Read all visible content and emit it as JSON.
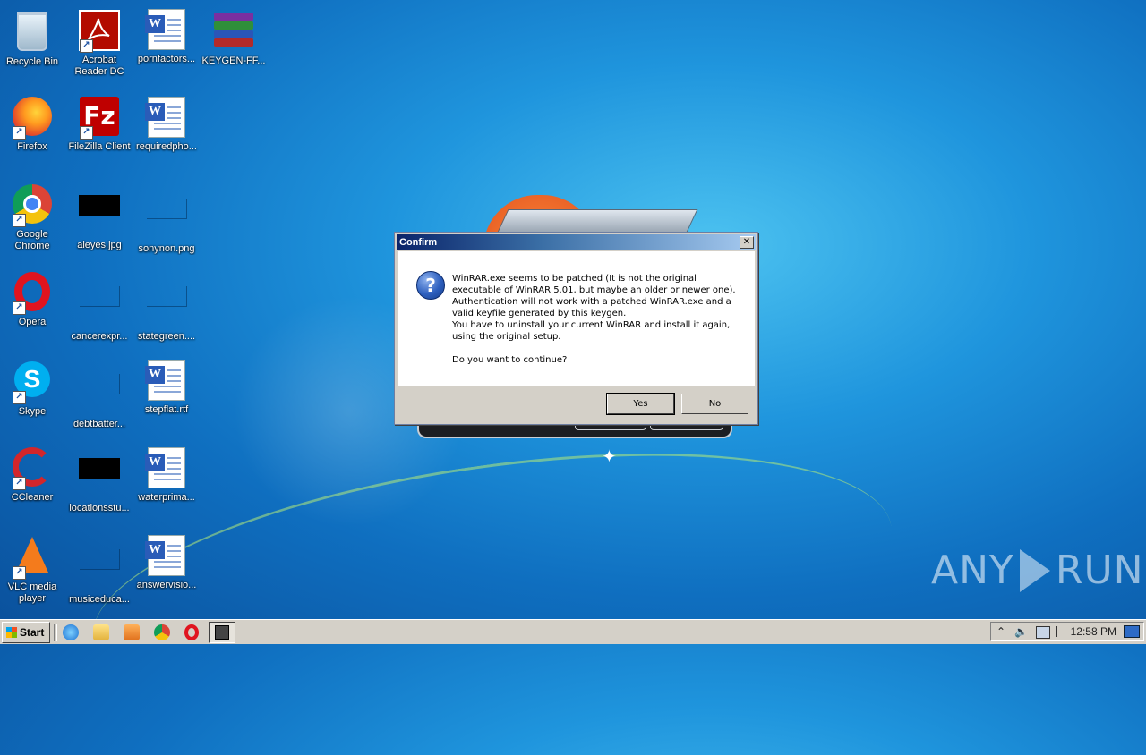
{
  "desktop": {
    "icons": [
      {
        "label": "Recycle Bin"
      },
      {
        "label": "Acrobat Reader DC"
      },
      {
        "label": "pornfactors..."
      },
      {
        "label": "KEYGEN-FF..."
      },
      {
        "label": "Firefox"
      },
      {
        "label": "FileZilla Client"
      },
      {
        "label": "requiredpho..."
      },
      {
        "label": "Google Chrome"
      },
      {
        "label": "aleyes.jpg"
      },
      {
        "label": "sonynon.png"
      },
      {
        "label": "Opera"
      },
      {
        "label": "cancerexpr..."
      },
      {
        "label": "stategreen...."
      },
      {
        "label": "Skype"
      },
      {
        "label": "debtbatter..."
      },
      {
        "label": "stepflat.rtf"
      },
      {
        "label": "CCleaner"
      },
      {
        "label": "locationsstu..."
      },
      {
        "label": "waterprima..."
      },
      {
        "label": "VLC media player"
      },
      {
        "label": "musiceduca..."
      },
      {
        "label": "answervisio..."
      }
    ]
  },
  "dialog": {
    "title": "Confirm",
    "close_glyph": "✕",
    "icon": "question-icon",
    "message_lines": [
      "WinRAR.exe seems to be patched (It is not the original",
      "executable of WinRAR 5.01, but maybe an older or newer one).",
      "Authentication will not work with a patched WinRAR.exe and a",
      "valid keyfile generated by this keygen.",
      "You have to uninstall your current WinRAR and install it again,",
      "using the original setup."
    ],
    "question": "Do you want to continue?",
    "yes_label": "Yes",
    "no_label": "No"
  },
  "watermark": {
    "left": "ANY",
    "right": "RUN"
  },
  "taskbar": {
    "start_label": "Start",
    "quick_launch": [
      "internet-explorer-icon",
      "folder-icon",
      "media-player-icon",
      "chrome-icon",
      "opera-icon"
    ],
    "tray_expand": "⌃",
    "tray_volume": "🔈",
    "clock": "12:58 PM"
  },
  "colors": {
    "title_gradient_start": "#0a246a",
    "title_gradient_end": "#a6caf0",
    "desktop_blue": "#1f95dd"
  }
}
